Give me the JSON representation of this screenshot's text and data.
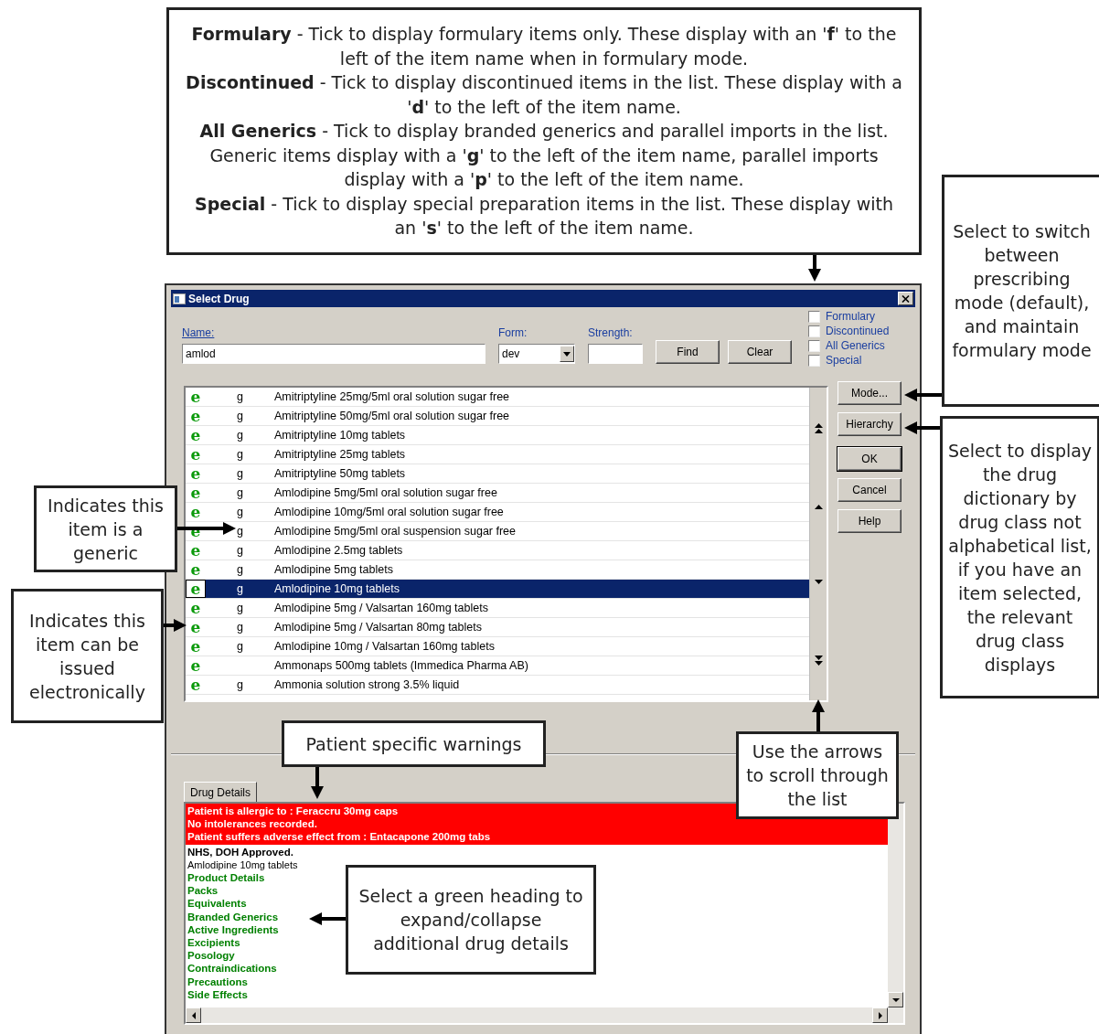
{
  "callouts": {
    "filters": [
      "**Formulary** - Tick to display formulary items only. These display with an '**f**' to the left of the item name when in formulary mode.",
      "**Discontinued** - Tick to display discontinued items in the list. These display with a '**d**' to the left of the item name.",
      "**All Generics** - Tick to display branded generics and parallel imports in the list. Generic items display with a '**g**' to the left of the item name, parallel imports display with a '**p**' to the left of the item name.",
      "**Special** - Tick to display special preparation items in the list. These display with an '**s**' to the left of the item name."
    ],
    "mode": "Select to switch between prescribing mode (default), and maintain formulary mode",
    "hierarchy": "Select to display the drug dictionary by drug class not alphabetical list, if you have an item selected, the relevant drug class displays",
    "generic": "Indicates this item is a generic",
    "electronic": "Indicates this item can be issued electronically",
    "warnings": "Patient specific warnings",
    "scroll": "Use the arrows to scroll through the list",
    "headings": "Select a green heading to expand/collapse additional drug details"
  },
  "window": {
    "title": "Select Drug",
    "fields": {
      "name": {
        "label": "Name:",
        "value": "amlod"
      },
      "form": {
        "label": "Form:",
        "value": "dev"
      },
      "strength": {
        "label": "Strength:"
      }
    },
    "search_buttons": [
      "Find",
      "Clear"
    ],
    "filters": [
      {
        "label": "Formulary",
        "checked": false
      },
      {
        "label": "Discontinued",
        "checked": false
      },
      {
        "label": "All Generics",
        "checked": false
      },
      {
        "label": "Special",
        "checked": false
      }
    ],
    "drugs": [
      {
        "issue": "e",
        "type": "g",
        "name": "Amitriptyline 25mg/5ml oral solution sugar free",
        "selected": false
      },
      {
        "issue": "e",
        "type": "g",
        "name": "Amitriptyline 50mg/5ml oral solution sugar free",
        "selected": false
      },
      {
        "issue": "e",
        "type": "g",
        "name": "Amitriptyline 10mg tablets",
        "selected": false
      },
      {
        "issue": "e",
        "type": "g",
        "name": "Amitriptyline 25mg tablets",
        "selected": false
      },
      {
        "issue": "e",
        "type": "g",
        "name": "Amitriptyline 50mg tablets",
        "selected": false
      },
      {
        "issue": "e",
        "type": "g",
        "name": "Amlodipine 5mg/5ml oral solution sugar free",
        "selected": false
      },
      {
        "issue": "e",
        "type": "g",
        "name": "Amlodipine 10mg/5ml oral solution sugar free",
        "selected": false
      },
      {
        "issue": "e",
        "type": "g",
        "name": "Amlodipine 5mg/5ml oral suspension sugar free",
        "selected": false
      },
      {
        "issue": "e",
        "type": "g",
        "name": "Amlodipine 2.5mg tablets",
        "selected": false
      },
      {
        "issue": "e",
        "type": "g",
        "name": "Amlodipine 5mg tablets",
        "selected": false
      },
      {
        "issue": "e",
        "type": "g",
        "name": "Amlodipine 10mg tablets",
        "selected": true
      },
      {
        "issue": "e",
        "type": "g",
        "name": "Amlodipine 5mg / Valsartan 160mg tablets",
        "selected": false
      },
      {
        "issue": "e",
        "type": "g",
        "name": "Amlodipine 5mg / Valsartan 80mg tablets",
        "selected": false
      },
      {
        "issue": "e",
        "type": "g",
        "name": "Amlodipine 10mg / Valsartan 160mg tablets",
        "selected": false
      },
      {
        "issue": "e",
        "name": "Ammonaps 500mg tablets (Immedica Pharma AB)",
        "selected": false
      },
      {
        "issue": "e",
        "type": "g",
        "name": "Ammonia solution strong 3.5% liquid",
        "selected": false
      }
    ],
    "side_buttons": [
      "Mode...",
      "Hierarchy",
      "OK",
      "Cancel",
      "Help"
    ],
    "details_tab": {
      "label": "Drug Details",
      "selected": true
    },
    "details": {
      "warnings": [
        "Patient is allergic to : Feraccru 30mg caps",
        "No intolerances recorded.",
        "Patient suffers adverse effect from : Entacapone 200mg tabs"
      ],
      "approval": "NHS, DOH Approved.",
      "product": "Amlodipine 10mg tablets",
      "headings": [
        "Product Details",
        "Packs",
        "Equivalents",
        "Branded Generics",
        "Active Ingredients",
        "Excipients",
        "Posology",
        "Contraindications",
        "Precautions",
        "Side Effects"
      ]
    }
  }
}
